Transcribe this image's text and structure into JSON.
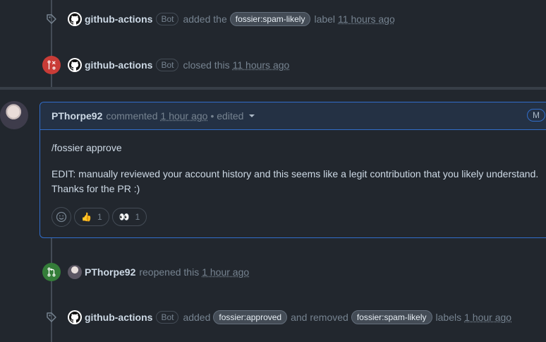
{
  "events": {
    "label_added": {
      "actor": "github-actions",
      "bot": "Bot",
      "text_before": "added the",
      "label": "fossier:spam-likely",
      "text_after": "label",
      "time": "11 hours ago"
    },
    "closed": {
      "actor": "github-actions",
      "bot": "Bot",
      "text": "closed this",
      "time": "11 hours ago"
    },
    "reopened": {
      "actor": "PThorpe92",
      "text": "reopened this",
      "time": "1 hour ago"
    },
    "labels_changed": {
      "actor": "github-actions",
      "bot": "Bot",
      "text_added": "added",
      "added_label": "fossier:approved",
      "text_removed": "and removed",
      "removed_label": "fossier:spam-likely",
      "text_after": "labels",
      "time": "1 hour ago"
    }
  },
  "comment": {
    "author": "PThorpe92",
    "action": "commented",
    "time": "1 hour ago",
    "edited": "• edited",
    "badge": "M",
    "body_line1": "/fossier approve",
    "body_line2": "EDIT: manually reviewed your account history and this seems like a legit contribution that you likely understand. Thanks for the PR :)",
    "reactions": [
      {
        "emoji": "👍",
        "count": "1"
      },
      {
        "emoji": "👀",
        "count": "1"
      }
    ]
  },
  "colors": {
    "background": "#22272e",
    "accent_blue": "#316dca",
    "closed_red": "#c93c37",
    "open_green": "#347d39"
  }
}
